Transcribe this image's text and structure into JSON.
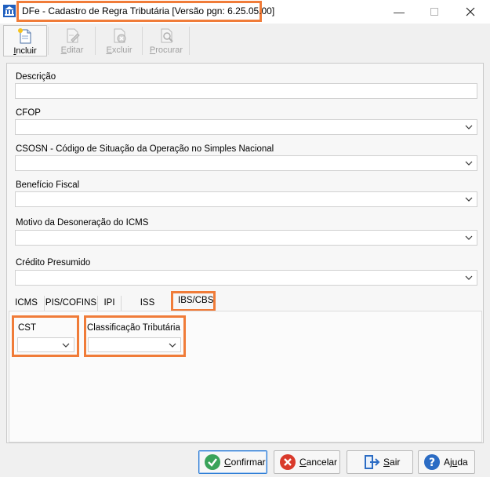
{
  "window": {
    "title": "DFe - Cadastro de Regra Tributária [Versão pgn: 6.25.05.00]"
  },
  "toolbar": {
    "incluir": {
      "first": "I",
      "rest": "ncluir"
    },
    "editar": {
      "first": "E",
      "rest": "ditar"
    },
    "excluir": {
      "first": "E",
      "rest": "xcluir"
    },
    "procurar": {
      "first": "P",
      "rest": "rocurar"
    }
  },
  "form": {
    "descricao": {
      "label": "Descrição",
      "value": ""
    },
    "cfop": {
      "label": "CFOP",
      "value": ""
    },
    "csosn": {
      "label": "CSOSN - Código de Situação da Operação no Simples Nacional",
      "value": ""
    },
    "beneficio": {
      "label": "Benefício Fiscal",
      "value": ""
    },
    "motivo": {
      "label": "Motivo da Desoneração do ICMS",
      "value": ""
    },
    "credito": {
      "label": "Crédito Presumido",
      "value": ""
    }
  },
  "tabs": {
    "icms": "ICMS",
    "pis_cofins": "PIS/COFINS",
    "ipi": "IPI",
    "iss": "ISS",
    "ibs_cbs": "IBS/CBS",
    "active": "IBS/CBS"
  },
  "ibs_cbs": {
    "cst": {
      "label": "CST",
      "value": ""
    },
    "classificacao": {
      "label": "Classificação Tributária",
      "value": ""
    }
  },
  "footer": {
    "confirmar": {
      "first": "C",
      "rest": "onfirmar"
    },
    "cancelar": {
      "first": "C",
      "rest": "ancelar"
    },
    "sair": {
      "first": "S",
      "rest": "air"
    },
    "ajuda": {
      "pre": "Aj",
      "ul": "u",
      "post": "da"
    }
  },
  "colors": {
    "highlight": "#f07c39",
    "confirm": "#3aa35a",
    "cancel": "#d93a2b",
    "help": "#2b6cc4"
  }
}
